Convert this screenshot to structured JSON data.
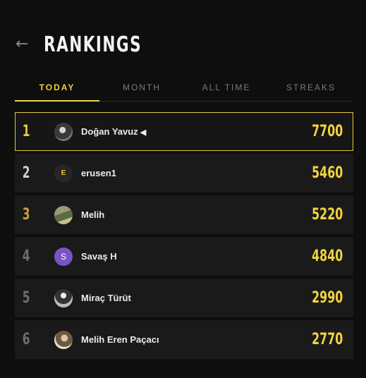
{
  "header": {
    "title": "RANKINGS",
    "back_glyph": "←"
  },
  "tabs": [
    {
      "label": "TODAY",
      "active": true
    },
    {
      "label": "MONTH",
      "active": false
    },
    {
      "label": "ALL TIME",
      "active": false
    },
    {
      "label": "STREAKS",
      "active": false
    }
  ],
  "rankings": [
    {
      "rank": "1",
      "name": "Doğan Yavuz",
      "marker": "◀",
      "score": "7700",
      "avatar": "photo"
    },
    {
      "rank": "2",
      "name": "erusen1",
      "score": "5460",
      "avatar_letter": "E"
    },
    {
      "rank": "3",
      "name": "Melih",
      "score": "5220",
      "avatar": "photo"
    },
    {
      "rank": "4",
      "name": "Savaş H",
      "score": "4840",
      "avatar_letter": "S"
    },
    {
      "rank": "5",
      "name": "Miraç Türüt",
      "score": "2990",
      "avatar": "photo"
    },
    {
      "rank": "6",
      "name": "Melih Eren Paçacı",
      "score": "2770",
      "avatar": "photo"
    }
  ],
  "colors": {
    "accent": "#f0d23c",
    "background": "#0e0e0e",
    "row": "#1a1a1a",
    "avatar_s": "#7755c7"
  }
}
